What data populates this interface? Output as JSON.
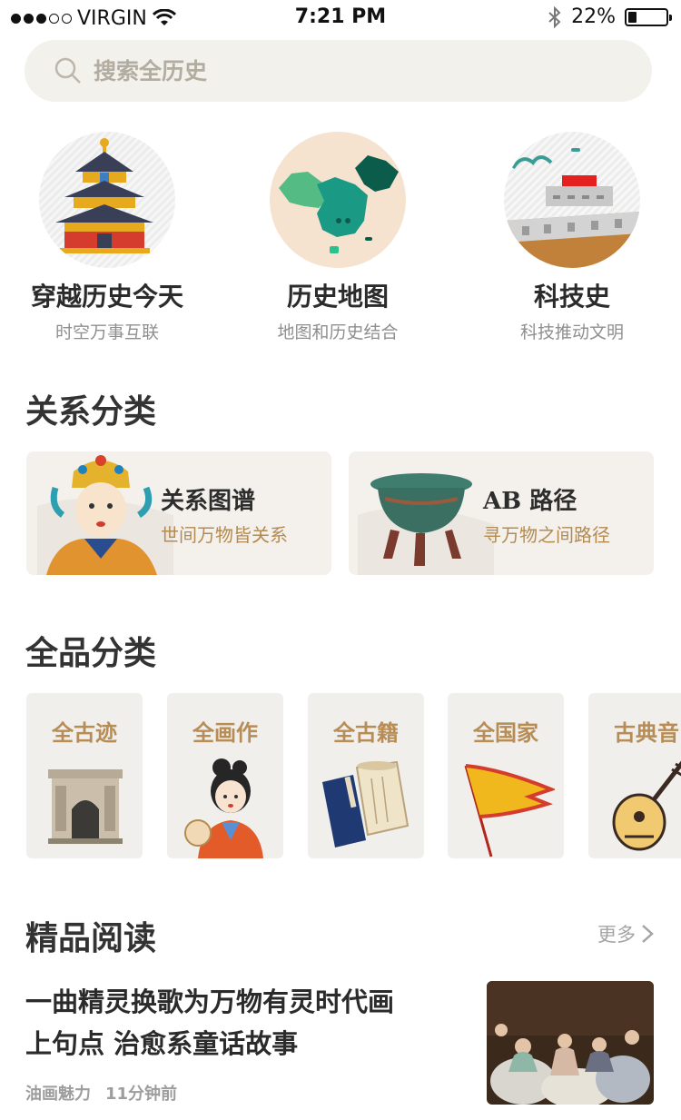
{
  "status_bar": {
    "carrier": "VIRGIN",
    "time": "7:21 PM",
    "battery": "22%",
    "battery_level": 0.22
  },
  "search": {
    "placeholder": "搜索全历史"
  },
  "features": [
    {
      "title": "穿越历史今天",
      "subtitle": "时空万事互联",
      "icon": "temple-icon"
    },
    {
      "title": "历史地图",
      "subtitle": "地图和历史结合",
      "icon": "china-map-icon"
    },
    {
      "title": "科技史",
      "subtitle": "科技推动文明",
      "icon": "great-wall-icon"
    }
  ],
  "sections": {
    "relations": "关系分类",
    "categories": "全品分类",
    "reading": "精品阅读"
  },
  "relation_cards": [
    {
      "title": "关系图谱",
      "subtitle": "世间万物皆关系",
      "icon": "empress-icon"
    },
    {
      "title": "AB 路径",
      "subtitle": "寻万物之间路径",
      "icon": "bronze-vessel-icon"
    }
  ],
  "category_tiles": [
    {
      "title": "全古迹",
      "icon": "arch-icon"
    },
    {
      "title": "全画作",
      "icon": "painting-lady-icon"
    },
    {
      "title": "全古籍",
      "icon": "scroll-book-icon"
    },
    {
      "title": "全国家",
      "icon": "flag-icon"
    },
    {
      "title": "古典音",
      "icon": "pipa-icon"
    }
  ],
  "reading": {
    "more": "更多",
    "article": {
      "title_line1": "一曲精灵换歌为万物有灵时代画",
      "title_line2": "上句点 治愈系童话故事",
      "category": "油画魅力",
      "time": "11分钟前"
    }
  },
  "colors": {
    "accent_gold": "#b78c55",
    "highlight": "#f6e6c4",
    "card_bg": "#f1efeb"
  }
}
